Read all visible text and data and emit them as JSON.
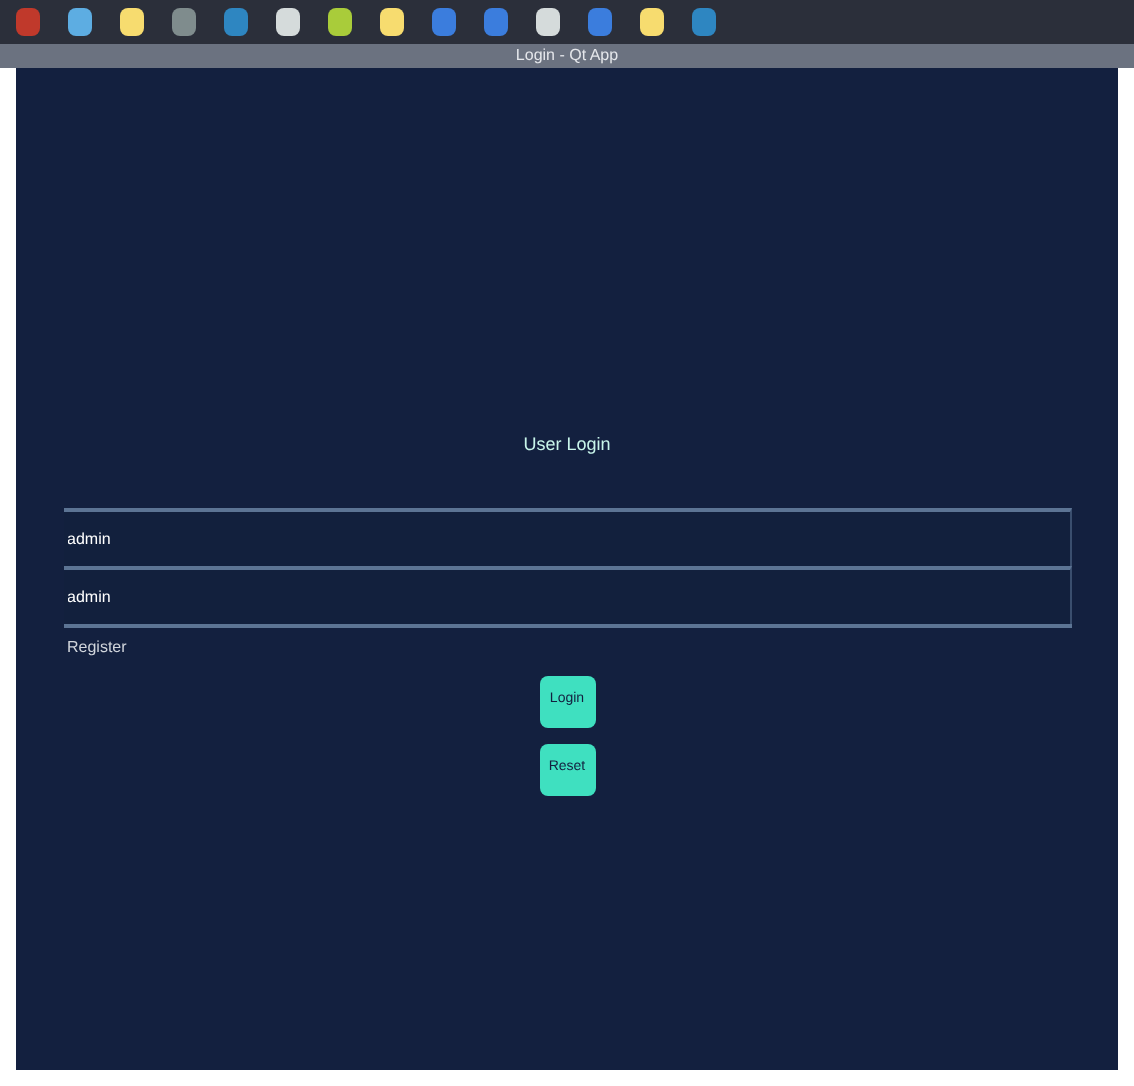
{
  "taskbar": {
    "apps": [
      {
        "color": "#c0392b"
      },
      {
        "color": "#5dade2"
      },
      {
        "color": "#f7dc6f"
      },
      {
        "color": "#7f8c8d"
      },
      {
        "color": "#2e86c1"
      },
      {
        "color": "#d5dbdb"
      },
      {
        "color": "#a9cc3a"
      },
      {
        "color": "#f7dc6f"
      },
      {
        "color": "#3b7ddd"
      },
      {
        "color": "#3b7ddd"
      },
      {
        "color": "#d5dbdb"
      },
      {
        "color": "#3b7ddd"
      },
      {
        "color": "#f7dc6f"
      },
      {
        "color": "#2e86c1"
      }
    ]
  },
  "window": {
    "title": "Login - Qt App"
  },
  "heading": "User Login",
  "fields": [
    {
      "value": "admin"
    },
    {
      "value": "admin"
    }
  ],
  "link": "Register",
  "buttons": [
    "Login",
    "Reset"
  ]
}
